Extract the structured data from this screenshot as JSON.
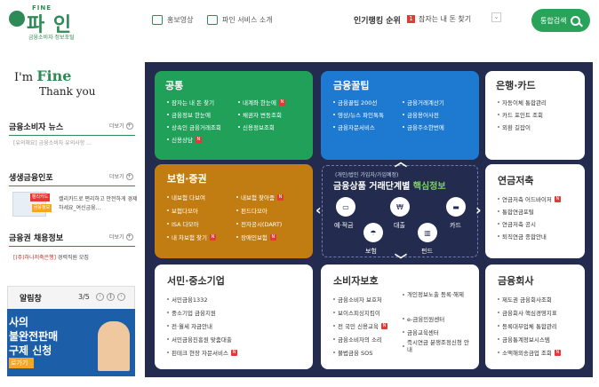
{
  "header": {
    "logo_small": "FINE",
    "logo_text": "파 인",
    "logo_sub": "금융소비자 정보포털",
    "link_video": "홍보영상",
    "link_service": "파인 서비스 소개",
    "rank_title": "인기랭킹 순위",
    "rank_num": "1",
    "rank_item": "잠자는 내 돈 찾기",
    "search_label": "통합검색"
  },
  "left": {
    "greet_prefix": "I'm",
    "greet_brand": "Fine",
    "greet_thank": "Thank you",
    "more": "더보기",
    "news_title": "금융소비자 뉴스",
    "news_text": "[유의해요] 금융소비자 유의사항 ...",
    "promo_title": "생생금융인포",
    "promo_tag1": "캘리카드",
    "promo_tag2": "금융정보",
    "promo_text": "캘리카드로 편리하고 안전하게 경제하세요_여신금융...",
    "jobs_title": "금융권 채용정보",
    "jobs_company": "[(주)하나저축은행]",
    "jobs_text": " 경력직원 모집",
    "notice_title": "알림창",
    "notice_page": "3/5",
    "banner_line1": "사의",
    "banner_line2": "불완전판매",
    "banner_line3": "구제 신청",
    "banner_btn": "로가기"
  },
  "tiles": {
    "common": {
      "title": "공통",
      "col1": [
        "잠자는 내 돈 찾기",
        "금융정보 한눈에",
        "상속인 금융거래조회",
        "신용상담"
      ],
      "col2": [
        "내계좌 한눈에",
        "채권자 변동조회",
        "신용정보조회"
      ]
    },
    "tips": {
      "title": "금융꿀팁",
      "col1": [
        "금융꿀팁 200선",
        "영상/뉴스 파인톡톡",
        "금융자문서비스"
      ],
      "col2": [
        "금융거래계산기",
        "금융용어사전",
        "금융주소한번에"
      ]
    },
    "bank": {
      "title": "은행·카드",
      "items": [
        "자동이체 통합관리",
        "카드 포인트 조회",
        "외환 길잡이"
      ]
    },
    "insurance": {
      "title": "보험·증권",
      "col1": [
        "내보험 다보여",
        "보험다모아",
        "ISA 다모아",
        "내 차보험 찾기"
      ],
      "col2": [
        "내보험 찾아줌",
        "펀드다모아",
        "전자공시(DART)",
        "장애인보험"
      ]
    },
    "center": {
      "sub": "(개인/법인 가입자/가입예정)",
      "title": "금융상품 거래단계별",
      "title_hl": "핵심정보",
      "labels": [
        "예·적금",
        "대출",
        "카드",
        "보험",
        "펀드"
      ]
    },
    "pension": {
      "title": "연금저축",
      "items": [
        "연금저축 어드바이저",
        "통합연금포털",
        "연금저축 공시",
        "퇴직연금 종합안내"
      ]
    },
    "sme": {
      "title": "서민·중소기업",
      "items": [
        "서민금융1332",
        "중소기업 금융지원",
        "전·월세 자금안내",
        "서민금융진흥원 맞춤대출",
        "핀테크 현장 자문서비스"
      ]
    },
    "protect": {
      "title": "소비자보호",
      "col1": [
        "금융소비자 보호처",
        "보이스피싱지킴이",
        "전 국민 신용교육",
        "금융소비자의 소리",
        "불법금융 SOS"
      ],
      "col2": [
        "개인정보노출 등록·해제",
        "e-금융민원센터",
        "금융교육센터",
        "즉시연금 분쟁조정신청 안내"
      ]
    },
    "company": {
      "title": "금융회사",
      "items": [
        "제도권 금융회사조회",
        "금융회사 핵심경영지표",
        "등록대부업체 통합관리",
        "금융통계정보시스템",
        "소액해외송금업 조회"
      ]
    }
  }
}
